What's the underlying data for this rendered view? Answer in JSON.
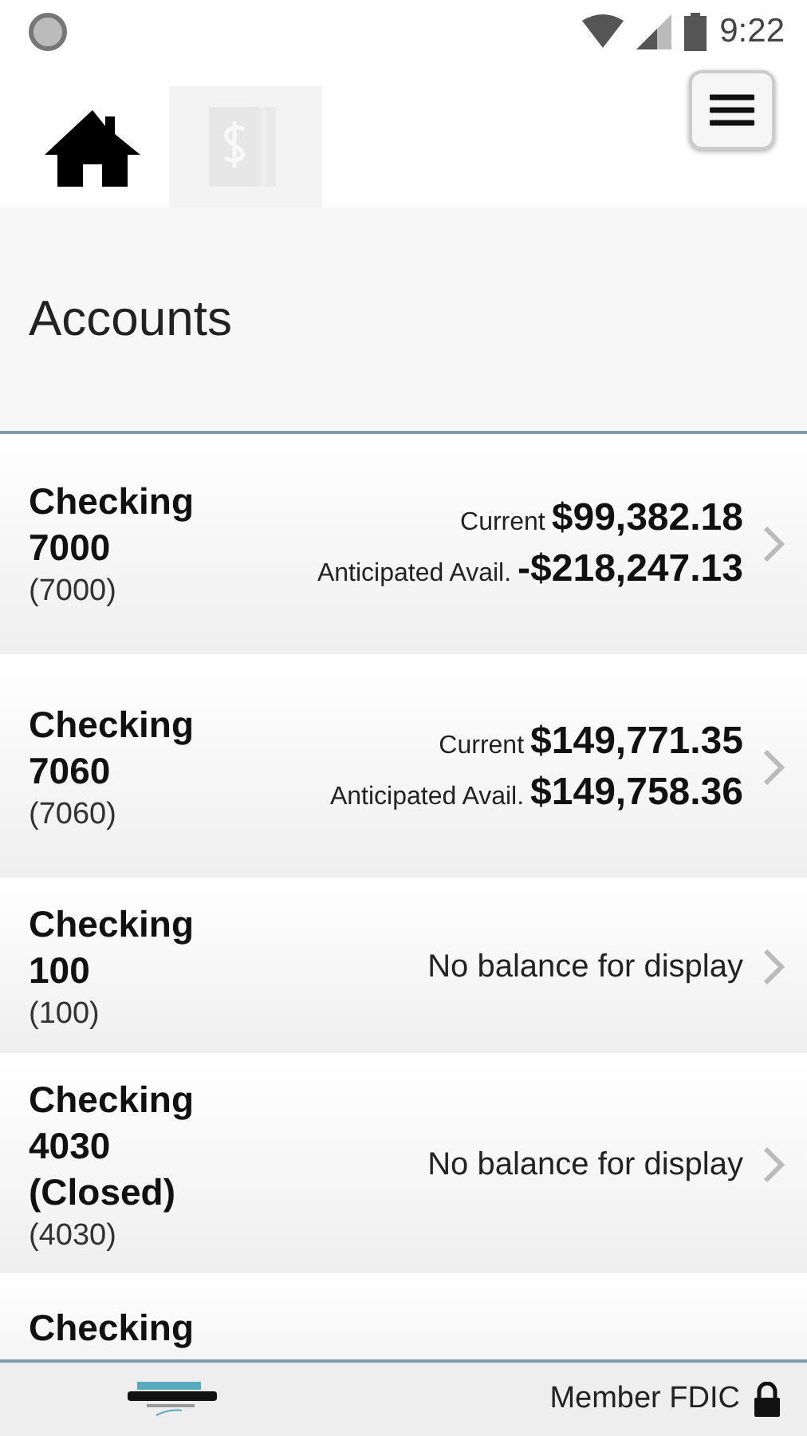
{
  "status_bar": {
    "time": "9:22"
  },
  "nav_tabs": [
    {
      "kind": "home",
      "selected": false
    },
    {
      "kind": "accounts",
      "selected": true
    }
  ],
  "page_title": "Accounts",
  "accounts": [
    {
      "name": "Checking 7000",
      "number": "(7000)",
      "kind": "balances",
      "balances": [
        {
          "label": "Current",
          "amount": "$99,382.18"
        },
        {
          "label": "Anticipated Avail.",
          "amount": "-$218,247.13"
        }
      ]
    },
    {
      "name": "Checking 7060",
      "number": "(7060)",
      "kind": "balances",
      "balances": [
        {
          "label": "Current",
          "amount": "$149,771.35"
        },
        {
          "label": "Anticipated Avail.",
          "amount": "$149,758.36"
        }
      ]
    },
    {
      "name": "Checking 100",
      "number": "(100)",
      "kind": "message",
      "message": "No balance for display"
    },
    {
      "name": "Checking 4030 (Closed)",
      "number": "(4030)",
      "kind": "message",
      "message": "No balance for display"
    },
    {
      "name": "Checking",
      "kind": "partial"
    }
  ],
  "footer": {
    "text": "Member FDIC"
  }
}
